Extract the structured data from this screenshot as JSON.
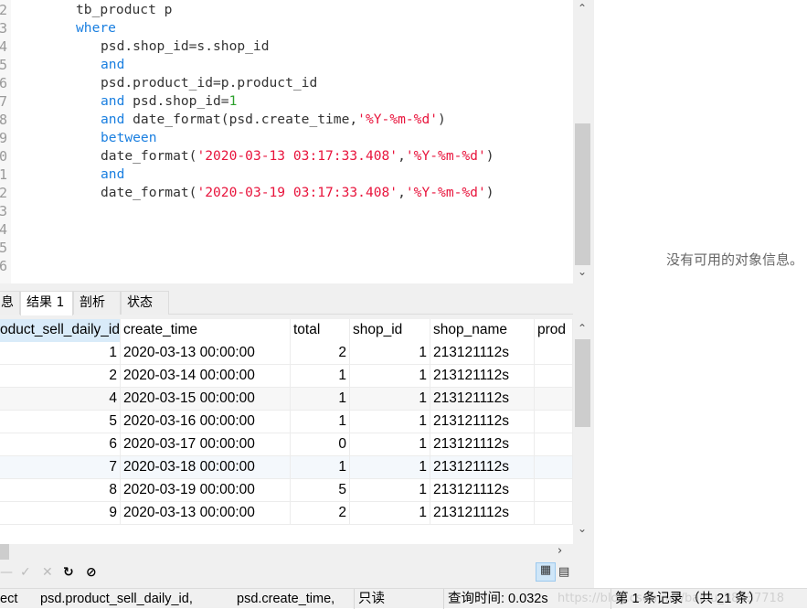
{
  "editor": {
    "line_numbers": [
      "2",
      "3",
      "4",
      "5",
      "6",
      "7",
      "8",
      "9",
      "0",
      "1",
      "2",
      "3",
      "4",
      "5",
      "6"
    ],
    "lines": [
      {
        "indent": 8,
        "tokens": [
          {
            "t": "tb_product p",
            "c": ""
          }
        ]
      },
      {
        "indent": 8,
        "tokens": [
          {
            "t": "where",
            "c": "kw"
          }
        ]
      },
      {
        "indent": 11,
        "tokens": [
          {
            "t": "psd.shop_id=s.shop_id",
            "c": ""
          }
        ]
      },
      {
        "indent": 11,
        "tokens": [
          {
            "t": "and",
            "c": "kw"
          }
        ]
      },
      {
        "indent": 11,
        "tokens": [
          {
            "t": "psd.product_id=p.product_id",
            "c": ""
          }
        ]
      },
      {
        "indent": 11,
        "tokens": [
          {
            "t": "and",
            "c": "kw"
          },
          {
            "t": " psd.shop_id=",
            "c": ""
          },
          {
            "t": "1",
            "c": "num"
          }
        ]
      },
      {
        "indent": 11,
        "tokens": [
          {
            "t": "and",
            "c": "kw"
          },
          {
            "t": " date_format(psd.create_time,",
            "c": ""
          },
          {
            "t": "'%Y-%m-%d'",
            "c": "str"
          },
          {
            "t": ")",
            "c": ""
          }
        ]
      },
      {
        "indent": 11,
        "tokens": [
          {
            "t": "between",
            "c": "kw"
          }
        ]
      },
      {
        "indent": 11,
        "tokens": [
          {
            "t": "date_format(",
            "c": ""
          },
          {
            "t": "'2020-03-13 03:17:33.408'",
            "c": "str"
          },
          {
            "t": ",",
            "c": ""
          },
          {
            "t": "'%Y-%m-%d'",
            "c": "str"
          },
          {
            "t": ")",
            "c": ""
          }
        ]
      },
      {
        "indent": 11,
        "tokens": [
          {
            "t": "and",
            "c": "kw"
          }
        ]
      },
      {
        "indent": 11,
        "tokens": [
          {
            "t": "date_format(",
            "c": ""
          },
          {
            "t": "'2020-03-19 03:17:33.408'",
            "c": "str"
          },
          {
            "t": ",",
            "c": ""
          },
          {
            "t": "'%Y-%m-%d'",
            "c": "str"
          },
          {
            "t": ")",
            "c": ""
          }
        ]
      }
    ]
  },
  "tabs": [
    {
      "label": "息",
      "active": false
    },
    {
      "label": "结果 1",
      "active": true
    },
    {
      "label": "剖析",
      "active": false
    },
    {
      "label": "状态",
      "active": false
    }
  ],
  "grid": {
    "columns": [
      "oduct_sell_daily_id",
      "create_time",
      "total",
      "shop_id",
      "shop_name",
      "prod"
    ],
    "rows": [
      [
        "1",
        "2020-03-13 00:00:00",
        "2",
        "1",
        "213121112s",
        ""
      ],
      [
        "2",
        "2020-03-14 00:00:00",
        "1",
        "1",
        "213121112s",
        ""
      ],
      [
        "4",
        "2020-03-15 00:00:00",
        "1",
        "1",
        "213121112s",
        ""
      ],
      [
        "5",
        "2020-03-16 00:00:00",
        "1",
        "1",
        "213121112s",
        ""
      ],
      [
        "6",
        "2020-03-17 00:00:00",
        "0",
        "1",
        "213121112s",
        ""
      ],
      [
        "7",
        "2020-03-18 00:00:00",
        "1",
        "1",
        "213121112s",
        ""
      ],
      [
        "8",
        "2020-03-19 00:00:00",
        "5",
        "1",
        "213121112s",
        ""
      ],
      [
        "9",
        "2020-03-13 00:00:00",
        "2",
        "1",
        "213121112s",
        ""
      ]
    ]
  },
  "status": {
    "sql_fragment_1": "ect",
    "sql_fragment_2": "psd.product_sell_daily_id,",
    "sql_fragment_3": "psd.create_time,",
    "mode": "只读",
    "query_time": "查询时间: 0.032s",
    "record": "第 1 条记录 （共 21 条）",
    "watermark": "https://blog.csdn.net/baidu_38837718"
  },
  "right_panel": {
    "message": "没有可用的对象信息。"
  },
  "colors": {
    "keyword": "#1a7fe0",
    "string": "#e8143c",
    "number": "#2ca02c",
    "selected_header": "#d9ebf9"
  }
}
